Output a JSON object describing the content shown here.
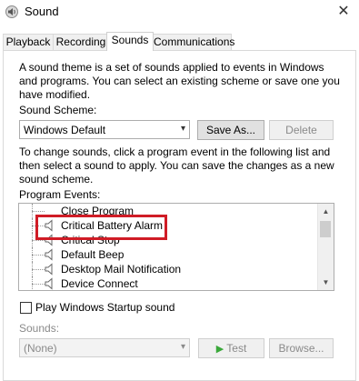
{
  "window": {
    "title": "Sound",
    "close_glyph": "✕"
  },
  "tabs": [
    {
      "label": "Playback",
      "active": false
    },
    {
      "label": "Recording",
      "active": false
    },
    {
      "label": "Sounds",
      "active": true
    },
    {
      "label": "Communications",
      "active": false
    }
  ],
  "intro": {
    "line1": "A sound theme is a set of sounds applied to events in Windows",
    "line2": "and programs.  You can select an existing scheme or save one you",
    "line3": "have modified."
  },
  "scheme": {
    "label": "Sound Scheme:",
    "selected": "Windows Default",
    "save_as": "Save As...",
    "delete": "Delete"
  },
  "instructions": {
    "line1": "To change sounds, click a program event in the following list and",
    "line2": "then select a sound to apply.  You can save the changes as a new",
    "line3": "sound scheme."
  },
  "program_events": {
    "label": "Program Events:",
    "items": [
      "Close Program",
      "Critical Battery Alarm",
      "Critical Stop",
      "Default Beep",
      "Desktop Mail Notification",
      "Device Connect"
    ]
  },
  "startup": {
    "label": "Play Windows Startup sound",
    "checked": false
  },
  "sounds": {
    "label": "Sounds:",
    "selected": "(None)",
    "test": "Test",
    "browse": "Browse..."
  },
  "icons": {
    "app": "speaker-app-icon",
    "event": "speaker-icon",
    "play": "play-icon"
  },
  "colors": {
    "highlight_box": "#d01c26",
    "play_icon": "#3aa83a"
  }
}
